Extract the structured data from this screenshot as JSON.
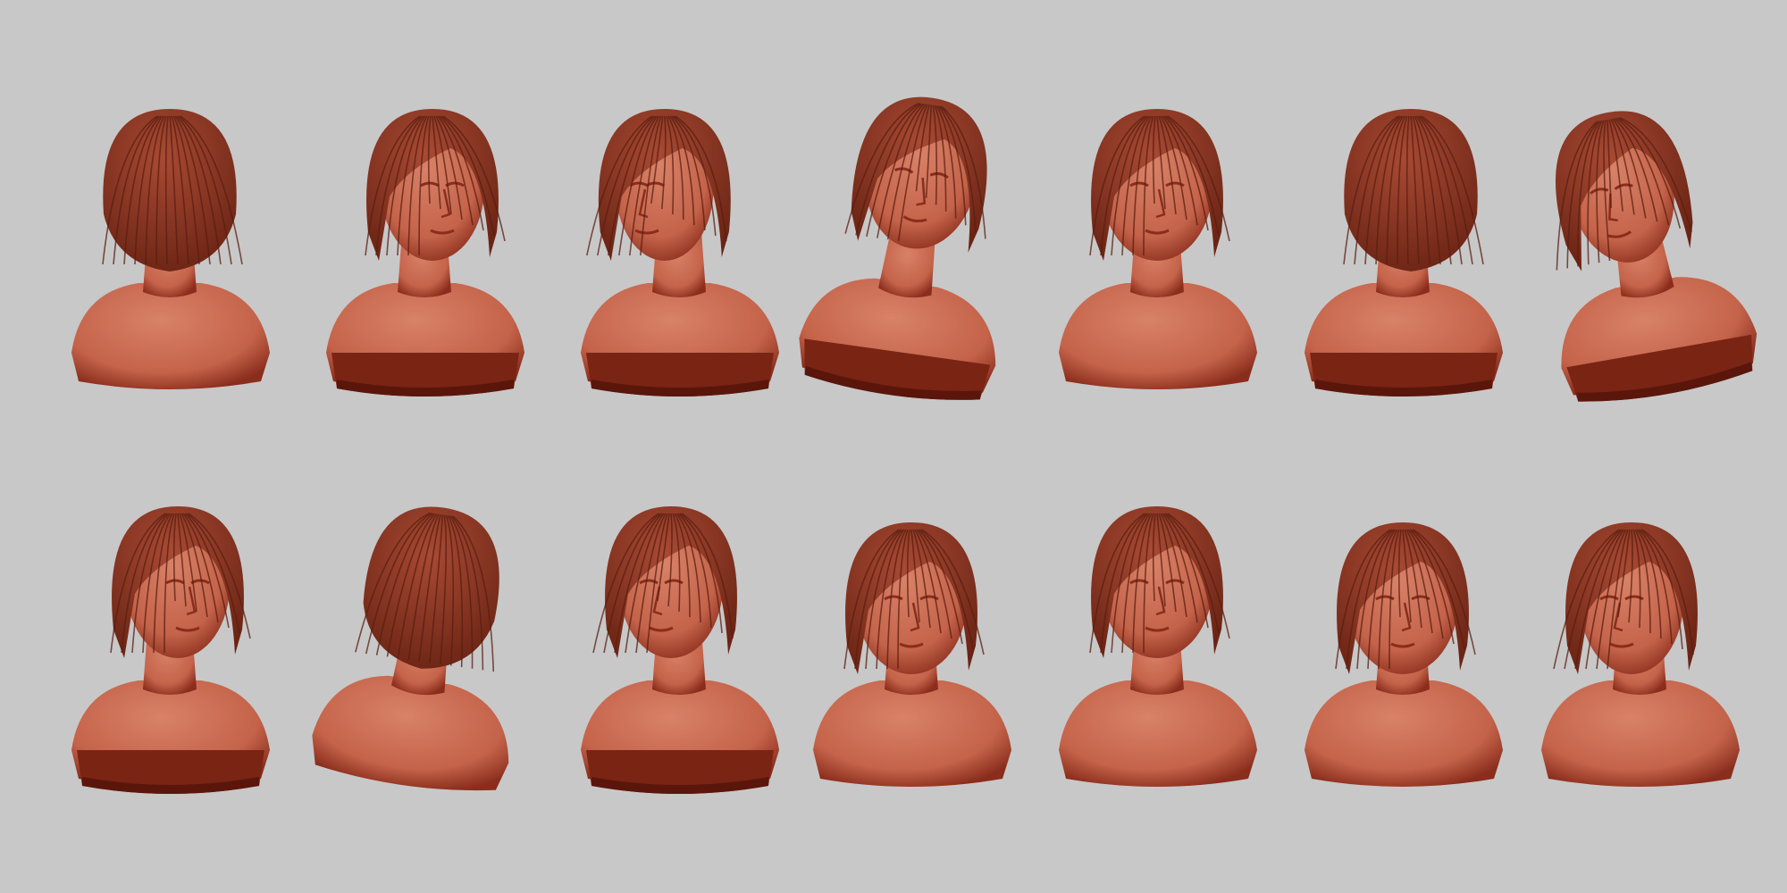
{
  "scene": {
    "background": "#c8c8c8",
    "material": {
      "skin_light": "#d88268",
      "skin_mid": "#c4634a",
      "skin_dark": "#8a2d1c",
      "hair": "#a84a34",
      "hair_dark": "#6b2414",
      "hair_strand": "#5a1e10",
      "base_dark": "#7a2414",
      "base_deep": "#5a160b"
    }
  },
  "rows": [
    {
      "name": "top-row",
      "busts": [
        {
          "view": "back",
          "base": false
        },
        {
          "view": "three-quarter-right",
          "base": true
        },
        {
          "view": "profile-left",
          "base": true
        },
        {
          "view": "front-tilted-up",
          "base": true
        },
        {
          "view": "front",
          "base": false
        },
        {
          "view": "back-three-quarter-right",
          "base": true
        },
        {
          "view": "three-quarter-left-tilted",
          "base": true
        }
      ]
    },
    {
      "name": "bottom-row",
      "busts": [
        {
          "view": "three-quarter-right",
          "base": true
        },
        {
          "view": "back-tilted",
          "base": false
        },
        {
          "view": "three-quarter-left",
          "base": true
        },
        {
          "view": "front-looking-down",
          "base": false
        },
        {
          "view": "front",
          "base": false
        },
        {
          "view": "front-top-down",
          "base": false
        },
        {
          "view": "three-quarter-left-down",
          "base": false
        }
      ]
    }
  ]
}
